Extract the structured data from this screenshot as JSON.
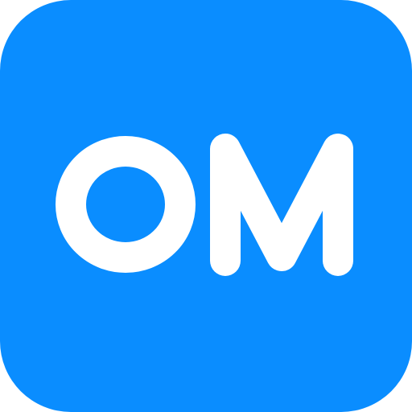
{
  "icon": {
    "text": "OM",
    "background_color": "#0A8DFF",
    "text_color": "#FFFFFF"
  }
}
